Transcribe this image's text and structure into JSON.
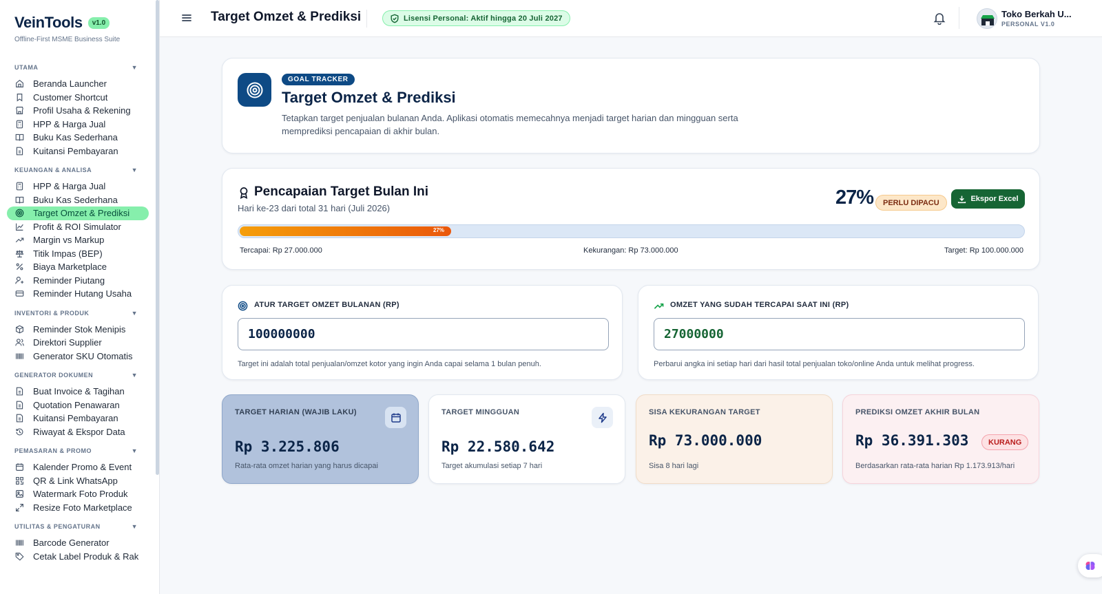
{
  "brand": {
    "name": "VeinTools",
    "version": "v1.0",
    "subtitle": "Offline-First MSME Business Suite"
  },
  "sidebar": {
    "sections": [
      {
        "title": "UTAMA",
        "items": [
          "Beranda Launcher",
          "Customer Shortcut",
          "Profil Usaha & Rekening",
          "HPP & Harga Jual",
          "Buku Kas Sederhana",
          "Kuitansi Pembayaran"
        ]
      },
      {
        "title": "KEUANGAN & ANALISA",
        "items": [
          "HPP & Harga Jual",
          "Buku Kas Sederhana",
          "Target Omzet & Prediksi",
          "Profit & ROI Simulator",
          "Margin vs Markup",
          "Titik Impas (BEP)",
          "Biaya Marketplace",
          "Reminder Piutang",
          "Reminder Hutang Usaha"
        ]
      },
      {
        "title": "INVENTORI & PRODUK",
        "items": [
          "Reminder Stok Menipis",
          "Direktori Supplier",
          "Generator SKU Otomatis"
        ]
      },
      {
        "title": "GENERATOR DOKUMEN",
        "items": [
          "Buat Invoice & Tagihan",
          "Quotation Penawaran",
          "Kuitansi Pembayaran",
          "Riwayat & Ekspor Data"
        ]
      },
      {
        "title": "PEMASARAN & PROMO",
        "items": [
          "Kalender Promo & Event",
          "QR & Link WhatsApp",
          "Watermark Foto Produk",
          "Resize Foto Marketplace"
        ]
      },
      {
        "title": "UTILITAS & PENGATURAN",
        "items": [
          "Barcode Generator",
          "Cetak Label Produk & Rak"
        ]
      }
    ]
  },
  "topbar": {
    "title": "Target Omzet & Prediksi",
    "license": "Lisensi Personal: Aktif hingga 20 Juli 2027",
    "user_name": "Toko Berkah U...",
    "user_plan": "PERSONAL V1.0"
  },
  "hero": {
    "badge": "GOAL TRACKER",
    "title": "Target Omzet & Prediksi",
    "description": "Tetapkan target penjualan bulanan Anda. Aplikasi otomatis memecahnya menjadi target harian dan mingguan serta memprediksi pencapaian di akhir bulan."
  },
  "progress": {
    "title": "Pencapaian Target Bulan Ini",
    "subtitle": "Hari ke-23 dari total 31 hari (Juli 2026)",
    "percent_text": "27%",
    "percent_value": 27,
    "status": "PERLU DIPACU",
    "export_label": "Ekspor Excel",
    "achieved": "Tercapai: Rp 27.000.000",
    "shortfall": "Kekurangan: Rp 73.000.000",
    "target": "Target: Rp 100.000.000"
  },
  "inputs": {
    "target": {
      "label": "ATUR TARGET OMZET BULANAN (RP)",
      "value": "100000000",
      "help": "Target ini adalah total penjualan/omzet kotor yang ingin Anda capai selama 1 bulan penuh."
    },
    "achieved": {
      "label": "OMZET YANG SUDAH TERCAPAI SAAT INI (RP)",
      "value": "27000000",
      "help": "Perbarui angka ini setiap hari dari hasil total penjualan toko/online Anda untuk melihat progress."
    }
  },
  "stats": {
    "daily": {
      "label": "TARGET HARIAN (WAJIB LAKU)",
      "value": "Rp 3.225.806",
      "note": "Rata-rata omzet harian yang harus dicapai"
    },
    "weekly": {
      "label": "TARGET MINGGUAN",
      "value": "Rp 22.580.642",
      "note": "Target akumulasi setiap 7 hari"
    },
    "remaining": {
      "label": "SISA KEKURANGAN TARGET",
      "value": "Rp 73.000.000",
      "note": "Sisa 8 hari lagi"
    },
    "forecast": {
      "label": "PREDIKSI OMZET AKHIR BULAN",
      "value": "Rp 36.391.303",
      "badge": "KURANG",
      "note": "Berdasarkan rata-rata harian Rp 1.173.913/hari"
    }
  },
  "colors": {
    "primary": "#0e4a85",
    "accent_green": "#86efac",
    "export_green": "#166534",
    "progress_orange": "#ea580c"
  }
}
